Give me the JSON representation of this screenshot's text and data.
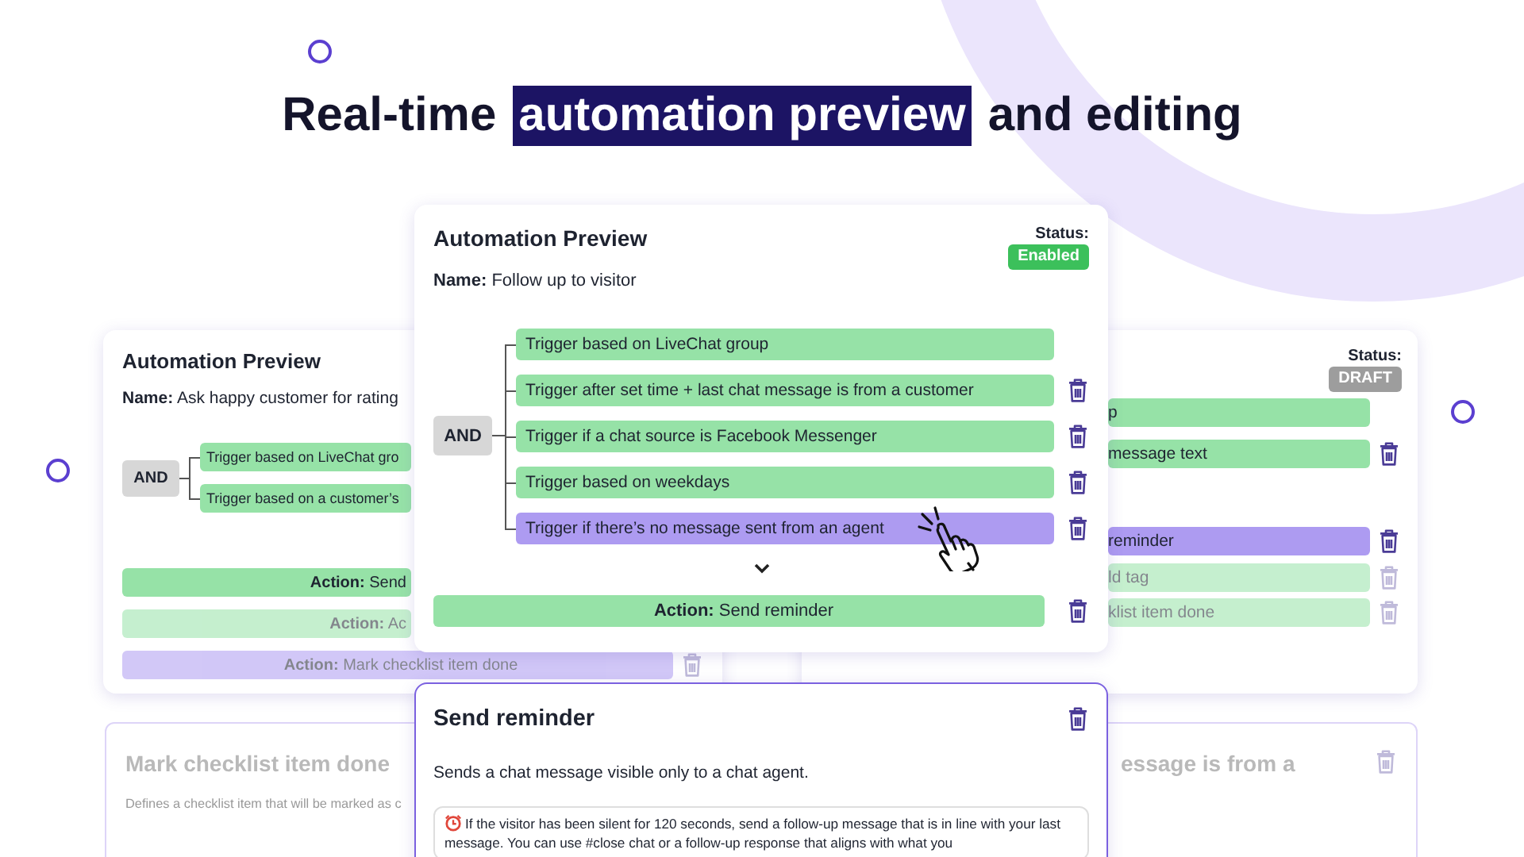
{
  "headline": [
    {
      "text": "Real-time",
      "highlighted": false
    },
    {
      "text": "automation preview",
      "highlighted": true
    },
    {
      "text": "and editing",
      "highlighted": false
    }
  ],
  "left_preview": {
    "title": "Automation Preview",
    "name_label": "Name:",
    "name": "Ask happy customer for rating",
    "operator": "AND",
    "triggers": [
      {
        "text": "Trigger based on LiveChat gro",
        "selected": false
      },
      {
        "text": "Trigger based on a customer’s",
        "selected": false
      }
    ],
    "actions": [
      {
        "text": "**Action:** Send",
        "selected": false,
        "dimmed": false,
        "removable": false
      },
      {
        "text": "**Action:** Ac",
        "selected": false,
        "dimmed": true,
        "removable": false
      },
      {
        "text": "**Action:** Mark checklist item done",
        "selected": true,
        "dimmed": true,
        "removable": true
      }
    ]
  },
  "right_preview": {
    "status_label": "Status:",
    "status": {
      "value": "DRAFT",
      "kind": "draft"
    },
    "triggers": [
      {
        "text": "p",
        "selected": false,
        "removable": false
      },
      {
        "text": "message text",
        "selected": false,
        "removable": true
      }
    ],
    "actions": [
      {
        "text": "reminder",
        "selected": true,
        "dimmed": false,
        "removable": true
      },
      {
        "text": "ld tag",
        "selected": false,
        "dimmed": true,
        "removable": true
      },
      {
        "text": "klist item done",
        "selected": false,
        "dimmed": true,
        "removable": true
      }
    ]
  },
  "main_preview": {
    "title": "Automation Preview",
    "status_label": "Status:",
    "status": {
      "value": "Enabled",
      "kind": "enabled"
    },
    "name_label": "Name:",
    "name": "Follow up to visitor",
    "operator": "AND",
    "triggers": [
      {
        "text": "Trigger based on LiveChat group",
        "selected": false,
        "removable": false
      },
      {
        "text": "Trigger after set time + last chat message is from a customer",
        "selected": false,
        "removable": true
      },
      {
        "text": "Trigger if a chat source is Facebook Messenger",
        "selected": false,
        "removable": true
      },
      {
        "text": "Trigger based on weekdays",
        "selected": false,
        "removable": true
      },
      {
        "text": "Trigger if there’s no message sent from an agent",
        "selected": true,
        "removable": true
      }
    ],
    "actions": [
      {
        "text": "**Action:** Send reminder",
        "selected": false,
        "dimmed": false,
        "removable": true
      }
    ]
  },
  "left_detail": {
    "title": "Mark checklist item done",
    "description": "Defines a checklist item that will be marked as c"
  },
  "right_detail": {
    "title": "essage is from a"
  },
  "reminder_editor": {
    "title": "Send reminder",
    "description": "Sends a chat message visible only to a chat agent.",
    "message": "If the visitor has been silent for 120 seconds, send a follow-up message that is in line with your last message. You can use #close chat or a follow-up response that aligns with what you"
  }
}
